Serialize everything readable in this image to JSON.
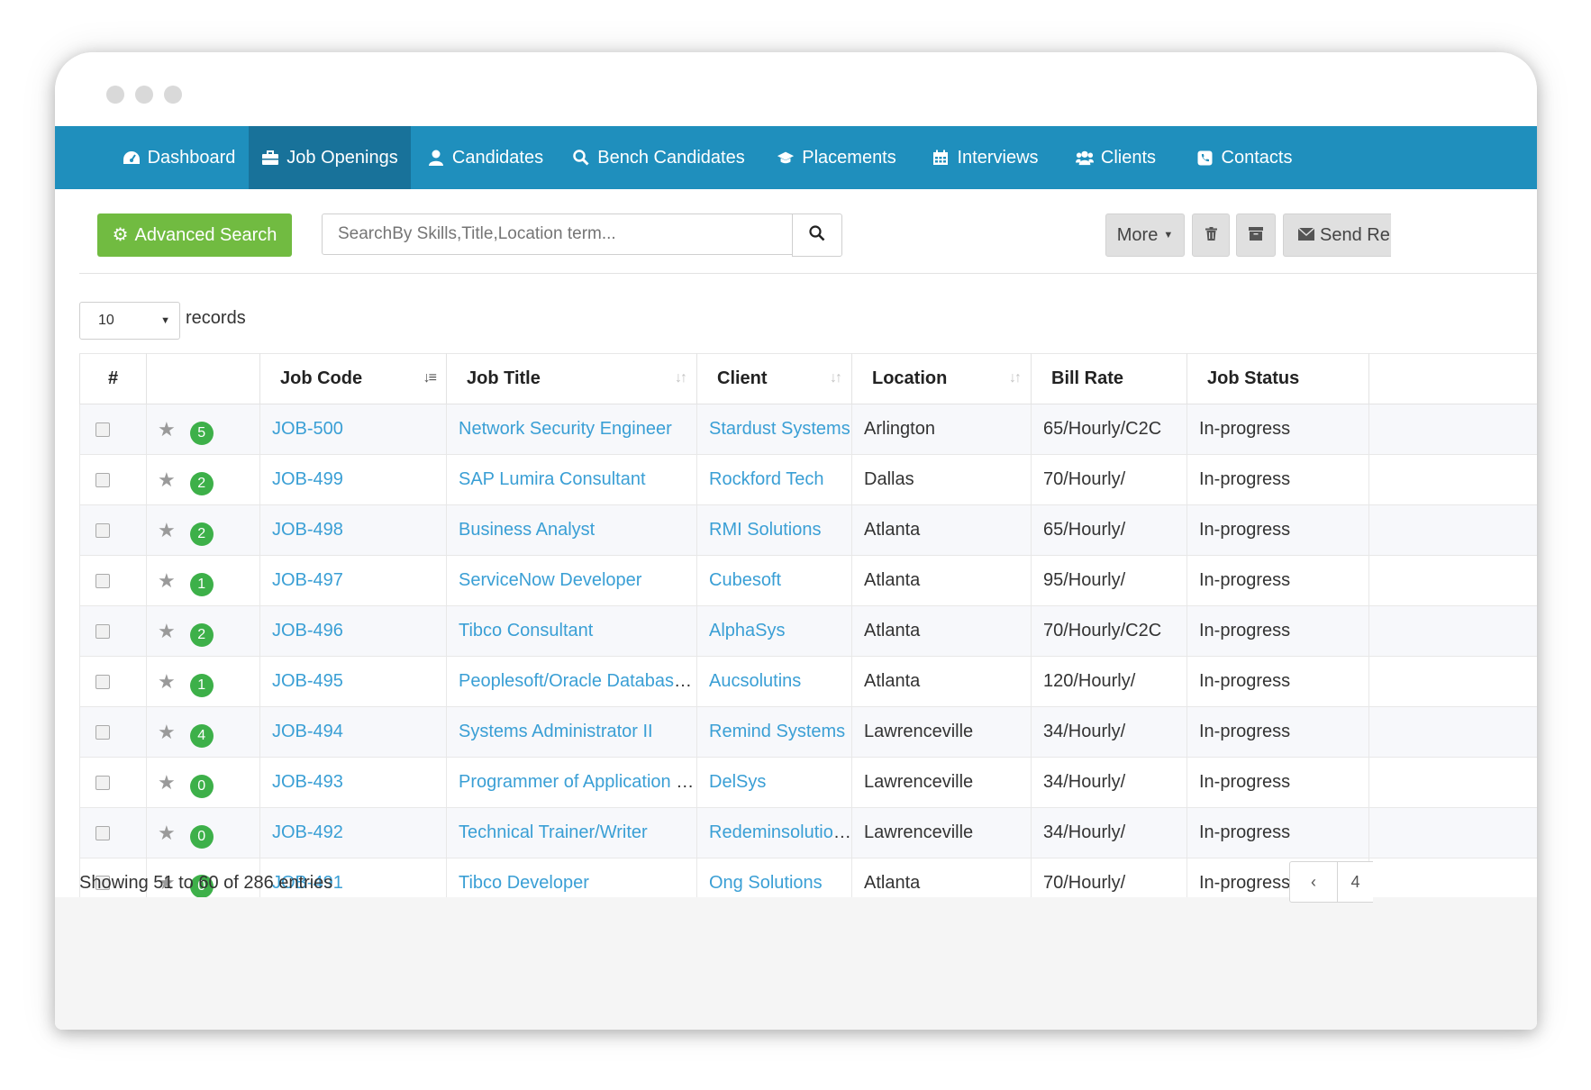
{
  "nav": {
    "items": [
      {
        "label": "Dashboard",
        "icon": "dashboard-icon"
      },
      {
        "label": "Job Openings",
        "icon": "briefcase-icon",
        "active": true
      },
      {
        "label": "Candidates",
        "icon": "user-icon"
      },
      {
        "label": "Bench Candidates",
        "icon": "search-icon"
      },
      {
        "label": "Placements",
        "icon": "graduation-cap-icon"
      },
      {
        "label": "Interviews",
        "icon": "calendar-icon"
      },
      {
        "label": "Clients",
        "icon": "users-icon"
      },
      {
        "label": "Contacts",
        "icon": "phone-icon"
      }
    ]
  },
  "toolbar": {
    "advanced_search_label": "Advanced Search",
    "search_placeholder": "SearchBy Skills,Title,Location term...",
    "more_label": "More",
    "send_label": "Send Re"
  },
  "length": {
    "value": "10",
    "records_label": "records"
  },
  "table": {
    "headers": {
      "num": "#",
      "job_code": "Job Code",
      "job_title": "Job Title",
      "client": "Client",
      "location": "Location",
      "bill_rate": "Bill Rate",
      "job_status": "Job Status"
    },
    "rows": [
      {
        "count": "5",
        "code": "JOB-500",
        "title": "Network Security Engineer",
        "client": "Stardust Systems",
        "location": "Arlington",
        "rate": "65/Hourly/C2C",
        "status": "In-progress"
      },
      {
        "count": "2",
        "code": "JOB-499",
        "title": "SAP Lumira Consultant",
        "client": "Rockford Tech",
        "location": "Dallas",
        "rate": "70/Hourly/",
        "status": "In-progress"
      },
      {
        "count": "2",
        "code": "JOB-498",
        "title": "Business Analyst",
        "client": "RMI Solutions",
        "location": "Atlanta",
        "rate": "65/Hourly/",
        "status": "In-progress"
      },
      {
        "count": "1",
        "code": "JOB-497",
        "title": "ServiceNow Developer",
        "client": "Cubesoft",
        "location": "Atlanta",
        "rate": "95/Hourly/",
        "status": "In-progress"
      },
      {
        "count": "2",
        "code": "JOB-496",
        "title": "Tibco Consultant",
        "client": "AlphaSys",
        "location": "Atlanta",
        "rate": "70/Hourly/C2C",
        "status": "In-progress"
      },
      {
        "count": "1",
        "code": "JOB-495",
        "title": "Peoplesoft/Oracle Database ...",
        "client": "Aucsolutins",
        "location": "Atlanta",
        "rate": "120/Hourly/",
        "status": "In-progress"
      },
      {
        "count": "4",
        "code": "JOB-494",
        "title": "Systems Administrator II",
        "client": "Remind Systems",
        "location": "Lawrenceville",
        "rate": "34/Hourly/",
        "status": "In-progress"
      },
      {
        "count": "0",
        "code": "JOB-493",
        "title": "Programmer of Application D...",
        "client": "DelSys",
        "location": "Lawrenceville",
        "rate": "34/Hourly/",
        "status": "In-progress"
      },
      {
        "count": "0",
        "code": "JOB-492",
        "title": "Technical Trainer/Writer",
        "client": "Redeminsolutions",
        "location": "Lawrenceville",
        "rate": "34/Hourly/",
        "status": "In-progress"
      },
      {
        "count": "0",
        "code": "JOB-491",
        "title": "Tibco Developer",
        "client": "Ong Solutions",
        "location": "Atlanta",
        "rate": "70/Hourly/",
        "status": "In-progress"
      }
    ]
  },
  "footer": {
    "info": "Showing 51 to 60 of 286 entries",
    "prev_label": "‹",
    "page_label": "4"
  },
  "colors": {
    "nav": "#1f8fbd",
    "nav_active": "#18729a",
    "advanced_search": "#71bb41",
    "link": "#3a9fd5",
    "badge": "#3db049"
  }
}
